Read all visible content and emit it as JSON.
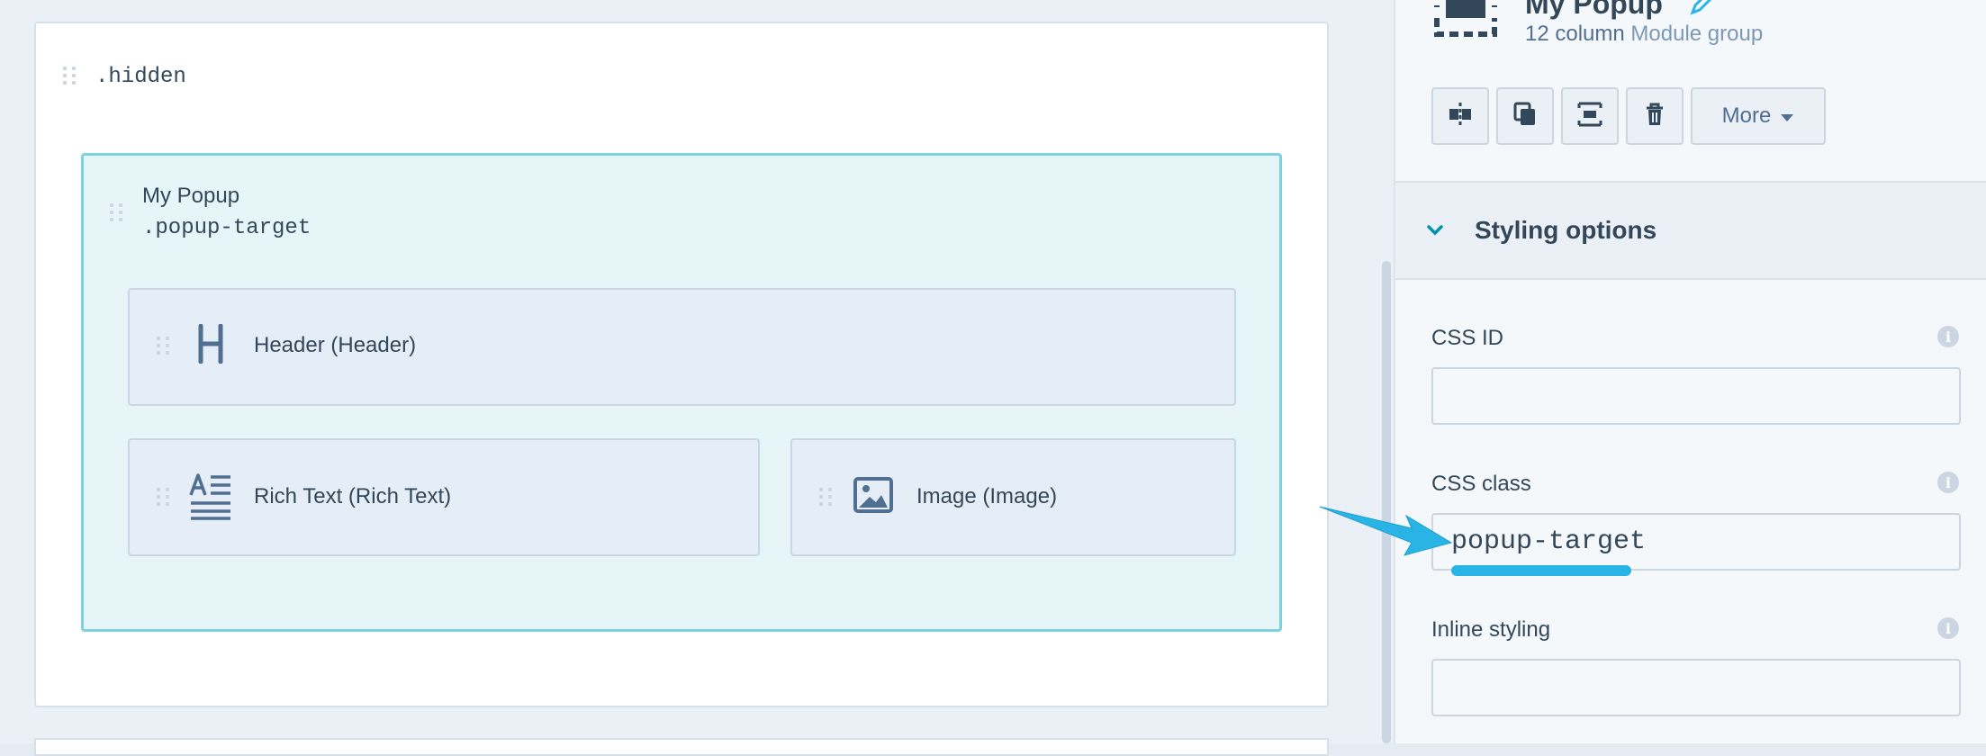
{
  "editor": {
    "hidden_row_class": ".hidden",
    "group": {
      "title": "My Popup",
      "class_label": ".popup-target"
    },
    "modules": {
      "header": {
        "label": "Header (Header)",
        "icon": "header-icon"
      },
      "rich_text": {
        "label": "Rich Text (Rich Text)",
        "icon": "rich-text-icon"
      },
      "image": {
        "label": "Image (Image)",
        "icon": "image-icon"
      }
    }
  },
  "panel": {
    "title": "My Popup",
    "subtitle_prefix": "12 column",
    "subtitle_link": "Module group",
    "toolbar": {
      "more_label": "More"
    },
    "section": {
      "title": "Styling options"
    },
    "fields": {
      "css_id": {
        "label": "CSS ID",
        "value": ""
      },
      "css_class": {
        "label": "CSS class",
        "value": "popup-target"
      },
      "inline_styling": {
        "label": "Inline styling",
        "value": ""
      }
    }
  },
  "colors": {
    "accent": "#2ab4e6",
    "group_border": "#7fd1de",
    "group_bg": "#e5f5f8",
    "text": "#33475b"
  }
}
